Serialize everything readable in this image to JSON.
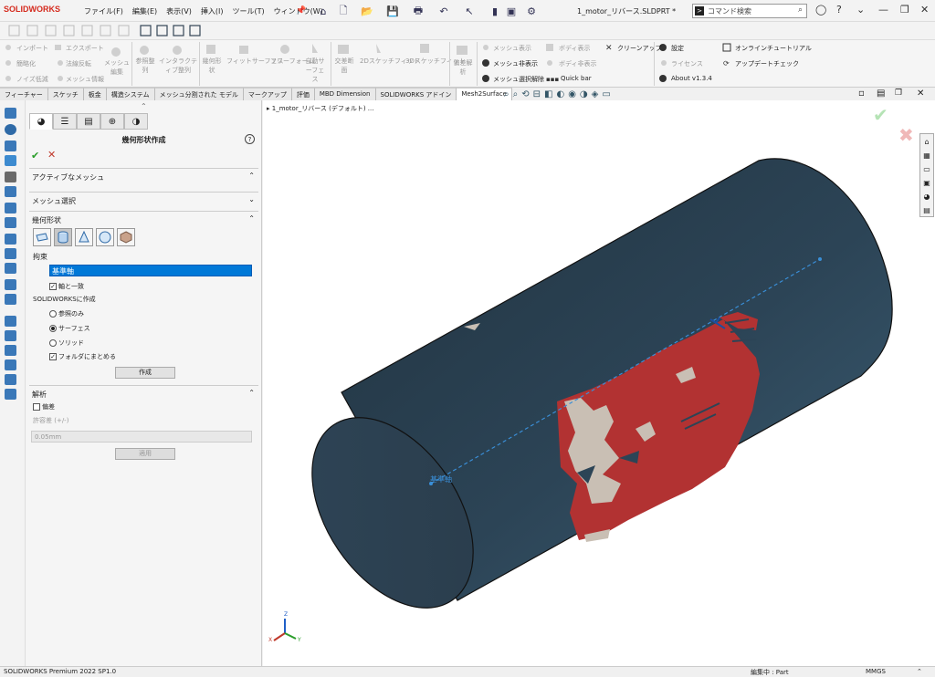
{
  "app": {
    "logo": "SOLIDWORKS",
    "document_title": "1_motor_リバース.SLDPRT *",
    "command_search_placeholder": "コマンド検索"
  },
  "menu": [
    "ファイル(F)",
    "編集(E)",
    "表示(V)",
    "挿入(I)",
    "ツール(T)",
    "ウィンドウ(W)"
  ],
  "command_manager": {
    "items": [
      {
        "label": "インポート",
        "enabled": false
      },
      {
        "label": "エクスポート",
        "enabled": false
      },
      {
        "label": "簡略化",
        "enabled": false
      },
      {
        "label": "法線反転",
        "enabled": false
      },
      {
        "label": "ノイズ低減",
        "enabled": false
      },
      {
        "label": "メッシュ情報",
        "enabled": false
      },
      {
        "label": "メッシュ編集",
        "enabled": false
      },
      {
        "label": "参照整列",
        "enabled": false
      },
      {
        "label": "インタラクティブ整列",
        "enabled": false
      },
      {
        "label": "幾何形状",
        "enabled": false
      },
      {
        "label": "フィットサーフェス",
        "enabled": false
      },
      {
        "label": "フリーフォーム",
        "enabled": false
      },
      {
        "label": "自動サーフェス",
        "enabled": false
      },
      {
        "label": "交差断面",
        "enabled": false
      },
      {
        "label": "2Dスケッチフィット",
        "enabled": false
      },
      {
        "label": "3Dスケッチフィット",
        "enabled": false
      },
      {
        "label": "偏差解析",
        "enabled": false
      },
      {
        "label": "メッシュ表示",
        "enabled": false
      },
      {
        "label": "ボディ表示",
        "enabled": false
      },
      {
        "label": "クリーンアップ",
        "enabled": true
      },
      {
        "label": "メッシュ非表示",
        "enabled": true
      },
      {
        "label": "ボディ非表示",
        "enabled": false
      },
      {
        "label": "メッシュ選択解除",
        "enabled": true
      },
      {
        "label": "Quick bar",
        "enabled": true
      },
      {
        "label": "設定",
        "enabled": true
      },
      {
        "label": "ライセンス",
        "enabled": false
      },
      {
        "label": "About v1.3.4",
        "enabled": true
      },
      {
        "label": "オンラインチュートリアル",
        "enabled": true
      },
      {
        "label": "アップデートチェック",
        "enabled": true
      }
    ]
  },
  "tabs": [
    "フィーチャー",
    "スケッチ",
    "板金",
    "構造システム",
    "メッシュ分割された モデル",
    "マークアップ",
    "評価",
    "MBD Dimension",
    "SOLIDWORKS アドイン",
    "Mesh2Surface"
  ],
  "active_tab": "Mesh2Surface",
  "property_manager": {
    "title": "幾何形状作成",
    "sections": {
      "active_mesh": "アクティブなメッシュ",
      "mesh_select": "メッシュ選択",
      "geometry": "幾何形状",
      "analysis": "解析"
    },
    "constraint_label": "拘束",
    "constraint_value": "基準軸",
    "align_to_axis": "軸と一致",
    "create_in_sw": "SOLIDWORKSに作成",
    "reference_only": "参照のみ",
    "surface": "サーフェス",
    "solid": "ソリッド",
    "group_in_folder": "フォルダにまとめる",
    "create_button": "作成",
    "deviation": "偏差",
    "tolerance_label": "許容差 (+/-)",
    "tolerance_value": "0.05mm",
    "apply_button": "適用"
  },
  "viewport": {
    "breadcrumb": "1_motor_リバース (デフォルト) ...",
    "axis_label": "基準軸",
    "triad_x": "X",
    "triad_y": "Y",
    "triad_z": "Z"
  },
  "status": {
    "version": "SOLIDWORKS Premium 2022 SP1.0",
    "editing": "編集中 : Part",
    "units": "MMGS"
  },
  "colors": {
    "cylinder": "#2a3f4f",
    "mesh_red": "#b03030",
    "accent": "#0078d7",
    "axis_line": "#3a8fd8"
  }
}
